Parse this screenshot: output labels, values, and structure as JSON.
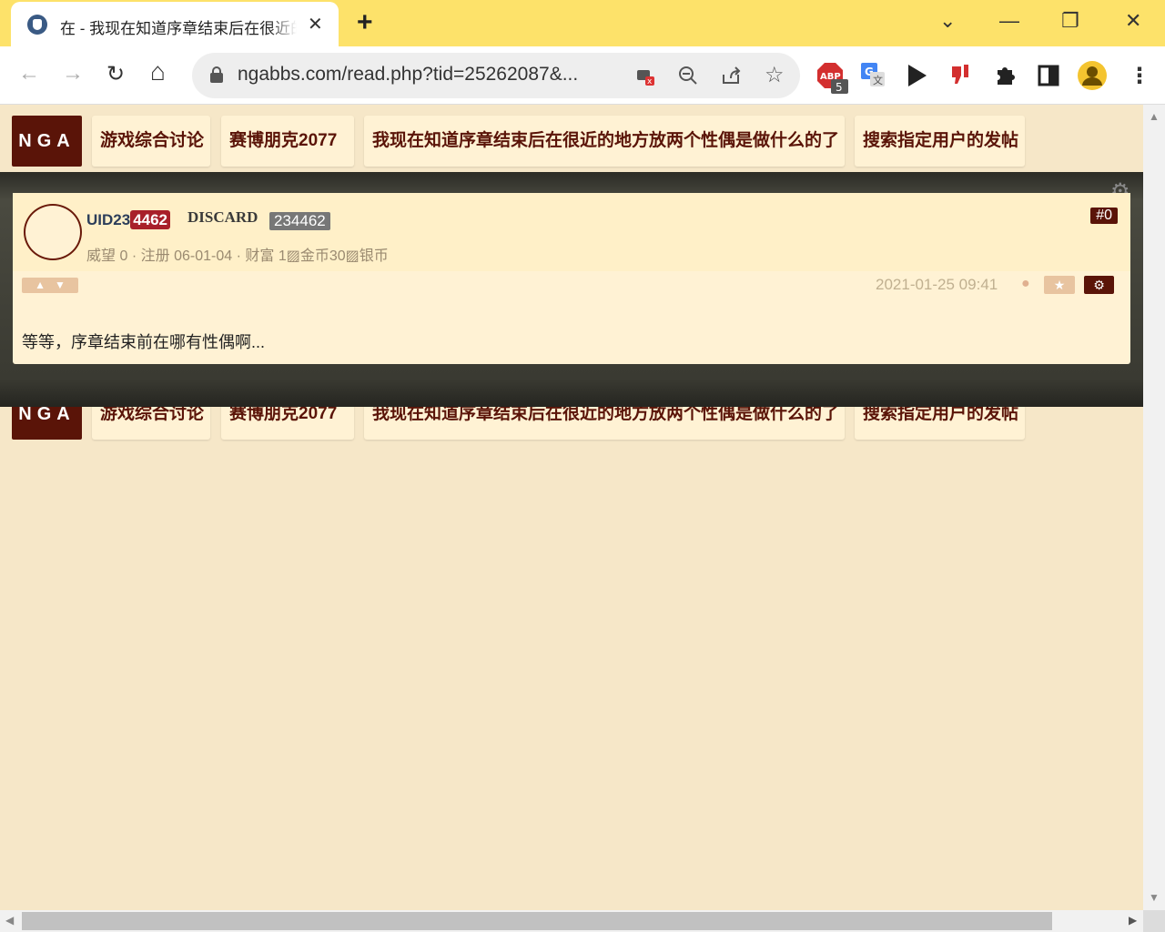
{
  "browser": {
    "tab_title": "在 - 我现在知道序章结束后在很近的地方放两个性偶是做什么的了",
    "tab_close": "✕",
    "new_tab": "+",
    "window_controls": {
      "minimize": "—",
      "restore": "❐",
      "close": "✕",
      "tabs_menu": "⌄"
    },
    "url": "ngabbs.com/read.php?tid=25262087&...",
    "nav": {
      "back": "←",
      "forward": "→",
      "reload": "↻",
      "home": "⌂"
    },
    "omnibox_icons": [
      "camera-blocked-icon",
      "zoom-icon",
      "share-icon",
      "star-icon"
    ],
    "extensions": {
      "abp_badge": "5"
    }
  },
  "nav_bar": {
    "logo": "NGA",
    "crumbs": [
      "游戏综合讨论",
      "赛博朋克2077",
      "我现在知道序章结束后在很近的地方放两个性偶是做什么的了",
      "搜索指定用户的发帖"
    ]
  },
  "post": {
    "username_prefix": "UID23",
    "username_highlight": "4462",
    "discard_label": "DISCARD",
    "uid_badge": "234462",
    "meta": {
      "prestige_label": "威望",
      "prestige_value": "0",
      "sep": "·",
      "register_label": "注册",
      "register_date": "06-01-04",
      "wealth_label": "财富",
      "wealth_value": "1",
      "gold_alt": "金币",
      "gold_value": "30",
      "silver_alt": "银币"
    },
    "floor": "#0",
    "timestamp": "2021-01-25 09:41",
    "content": "等等，序章结束前在哪有性偶啊..."
  }
}
